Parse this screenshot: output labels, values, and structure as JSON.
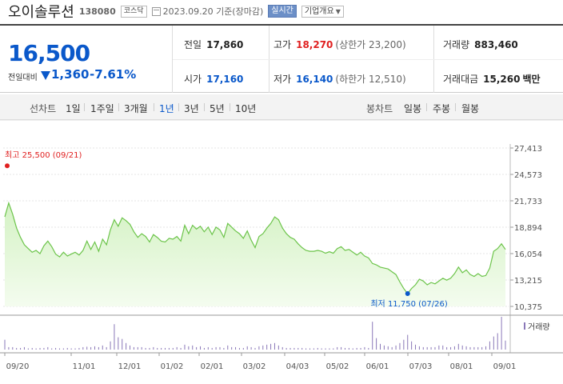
{
  "header": {
    "name": "오이솔루션",
    "code": "138080",
    "market_badge": "코스닥",
    "date_text": "2023.09.20 기준(장마감)",
    "realtime_label": "실시간",
    "company_info_label": "기업개요"
  },
  "summary": {
    "price": "16,500",
    "change_label": "전일대비",
    "change_amount": "1,360",
    "change_percent": "-7.61%",
    "prev_close": {
      "label": "전일",
      "value": "17,860"
    },
    "high": {
      "label": "고가",
      "value": "18,270",
      "sub": "(상한가 23,200)"
    },
    "volume": {
      "label": "거래량",
      "value": "883,460"
    },
    "open": {
      "label": "시가",
      "value": "17,160"
    },
    "low": {
      "label": "저가",
      "value": "16,140",
      "sub": "(하한가 12,510)"
    },
    "amount": {
      "label": "거래대금",
      "value": "15,260",
      "unit": "백만"
    }
  },
  "periods": {
    "line_label": "선차트",
    "line_items": [
      "1일",
      "1주일",
      "3개월",
      "1년",
      "3년",
      "5년",
      "10년"
    ],
    "active": "1년",
    "candle_label": "봉차트",
    "candle_items": [
      "일봉",
      "주봉",
      "월봉"
    ]
  },
  "colors": {
    "accent_blue": "#0a58ca",
    "up_red": "#e02020",
    "line_green": "#6cc44a",
    "fill_green": "#d4f2c4",
    "volume_bar": "#8a78b8"
  },
  "chart_data": {
    "type": "area",
    "x_tick_labels": [
      "09/20",
      "11/01",
      "12/01",
      "01/02",
      "02/01",
      "03/02",
      "04/03",
      "05/02",
      "06/01",
      "07/03",
      "08/01",
      "09/01"
    ],
    "y_tick_labels": [
      "27,413",
      "24,573",
      "21,733",
      "18,894",
      "16,054",
      "13,215",
      "10,375"
    ],
    "ylim": [
      10375,
      27413
    ],
    "high_annotation": "최고 25,500 (09/21)",
    "low_annotation": "최저 11,750 (07/26)",
    "volume_label": "거래량",
    "series": [
      {
        "values": [
          20000,
          21500,
          20300,
          18800,
          17800,
          17000,
          16600,
          16200,
          16400,
          16050,
          16900,
          17400,
          16800,
          16000,
          15700,
          16200,
          15800,
          16000,
          16200,
          15900,
          16400,
          17400,
          16500,
          17300,
          16300,
          17600,
          17000,
          18600,
          19700,
          19000,
          19900,
          19600,
          19200,
          18400,
          17800,
          18200,
          17900,
          17300,
          18100,
          17800,
          17400,
          17300,
          17700,
          17600,
          17900,
          17400,
          19100,
          18200,
          19100,
          18700,
          19000,
          18400,
          18900,
          18100,
          18900,
          18600,
          17800,
          19300,
          18900,
          18500,
          18200,
          17700,
          18500,
          17500,
          16700,
          17900,
          18200,
          18800,
          19300,
          20000,
          19700,
          18800,
          18200,
          17800,
          17600,
          17100,
          16700,
          16400,
          16300,
          16300,
          16400,
          16300,
          16100,
          16250,
          16100,
          16600,
          16800,
          16400,
          16500,
          16200,
          15900,
          16200,
          15800,
          15600,
          15000,
          14850,
          14600,
          14500,
          14400,
          14100,
          13800,
          13000,
          12300,
          11750,
          12300,
          12700,
          13300,
          13100,
          12700,
          12950,
          12800,
          13100,
          13400,
          13200,
          13400,
          13900,
          14600,
          14000,
          14300,
          13800,
          13600,
          13900,
          13600,
          13700,
          14500,
          16300,
          16600,
          17100,
          16500
        ]
      }
    ],
    "volume": [
      1.2,
      0.3,
      0.3,
      0.2,
      0.2,
      0.3,
      0.15,
      0.2,
      0.15,
      0.2,
      0.2,
      0.3,
      0.15,
      0.2,
      0.15,
      0.15,
      0.2,
      0.15,
      0.15,
      0.2,
      0.3,
      0.35,
      0.3,
      0.4,
      0.3,
      0.5,
      0.3,
      1.0,
      3.1,
      1.5,
      1.3,
      0.8,
      0.5,
      0.3,
      0.3,
      0.3,
      0.2,
      0.2,
      0.3,
      0.2,
      0.2,
      0.2,
      0.2,
      0.2,
      0.3,
      0.2,
      0.6,
      0.4,
      0.5,
      0.3,
      0.4,
      0.2,
      0.3,
      0.2,
      0.3,
      0.3,
      0.2,
      0.5,
      0.3,
      0.3,
      0.2,
      0.2,
      0.4,
      0.3,
      0.2,
      0.4,
      0.5,
      0.6,
      0.7,
      0.8,
      0.5,
      0.3,
      0.2,
      0.2,
      0.2,
      0.2,
      0.2,
      0.15,
      0.15,
      0.15,
      0.2,
      0.15,
      0.15,
      0.15,
      0.15,
      0.3,
      0.3,
      0.2,
      0.2,
      0.15,
      0.2,
      0.2,
      0.3,
      0.2,
      3.4,
      1.4,
      0.7,
      0.5,
      0.4,
      0.3,
      0.5,
      0.8,
      1.2,
      1.8,
      1.0,
      0.6,
      0.4,
      0.3,
      0.3,
      0.3,
      0.3,
      0.5,
      0.5,
      0.3,
      0.3,
      0.4,
      0.7,
      0.5,
      0.4,
      0.3,
      0.3,
      0.3,
      0.3,
      0.4,
      1.0,
      1.6,
      2.0,
      4.0,
      1.1
    ]
  }
}
